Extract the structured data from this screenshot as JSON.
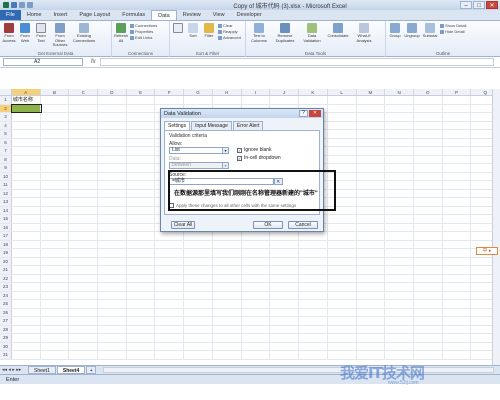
{
  "window": {
    "title": "Copy of 城市代码 (3).xlsx - Microsoft Excel",
    "min": "–",
    "max": "□",
    "close": "✕"
  },
  "ribbon_tabs": [
    "File",
    "Home",
    "Insert",
    "Page Layout",
    "Formulas",
    "Data",
    "Review",
    "View",
    "Developer"
  ],
  "ribbon": {
    "get_external": {
      "label": "Get External Data",
      "buttons": [
        "From Access",
        "From Web",
        "From Text",
        "From Other Sources",
        "Existing Connections"
      ]
    },
    "connections": {
      "label": "Connections",
      "refresh": "Refresh All",
      "small": [
        "Connections",
        "Properties",
        "Edit Links"
      ]
    },
    "sort_filter": {
      "label": "Sort & Filter",
      "sort": "Sort",
      "filter": "Filter",
      "small": [
        "Clear",
        "Reapply",
        "Advanced"
      ]
    },
    "data_tools": {
      "label": "Data Tools",
      "buttons": [
        "Text to Columns",
        "Remove Duplicates",
        "Data Validation",
        "Consolidate",
        "What-If Analysis"
      ]
    },
    "outline": {
      "label": "Outline",
      "buttons": [
        "Group",
        "Ungroup",
        "Subtotal"
      ],
      "small": [
        "Show Detail",
        "Hide Detail"
      ]
    }
  },
  "formula_bar": {
    "name_box": "A2",
    "fx": "fx",
    "value": ""
  },
  "grid": {
    "columns": [
      "A",
      "B",
      "C",
      "D",
      "E",
      "F",
      "G",
      "H",
      "I",
      "J",
      "K",
      "L",
      "M",
      "N",
      "O",
      "P",
      "Q"
    ],
    "rows": [
      "1",
      "2",
      "3",
      "4",
      "5",
      "6",
      "7",
      "8",
      "9",
      "10",
      "11",
      "12",
      "13",
      "14",
      "15",
      "16",
      "17",
      "18",
      "19",
      "20",
      "21",
      "22",
      "23",
      "24",
      "25",
      "26",
      "27",
      "28",
      "29",
      "30",
      "31"
    ],
    "a1": "城市名称"
  },
  "sheets": {
    "tabs": [
      "Sheet1",
      "Sheet4"
    ],
    "active": "Sheet4",
    "add": "+"
  },
  "status": {
    "text": "Enter"
  },
  "dialog": {
    "title": "Data Validation",
    "help": "?",
    "close": "✕",
    "tabs": [
      "Settings",
      "Input Message",
      "Error Alert"
    ],
    "criteria_label": "Validation criteria",
    "allow_label": "Allow:",
    "allow_value": "List",
    "data_label": "Data:",
    "data_value": "between",
    "ignore_blank": "Ignore blank",
    "in_cell_dropdown": "In-cell dropdown",
    "source_label": "Source:",
    "source_value": "=城市",
    "apply_note": "Apply these changes to all other cells with the same settings",
    "clear_all": "Clear All",
    "ok": "OK",
    "cancel": "Cancel"
  },
  "annotation": {
    "text": "在数据源那里填写我们刚刚在名称管理器新建的\"城市\""
  },
  "side_widget": {
    "text": "中 ▸"
  },
  "watermark": {
    "main": "我爱IT技术网",
    "sub": "www.52ij.com"
  },
  "colors": {
    "accent": "#2f6ab3",
    "cell_fill": "#8db24a",
    "close": "#c9463d"
  }
}
